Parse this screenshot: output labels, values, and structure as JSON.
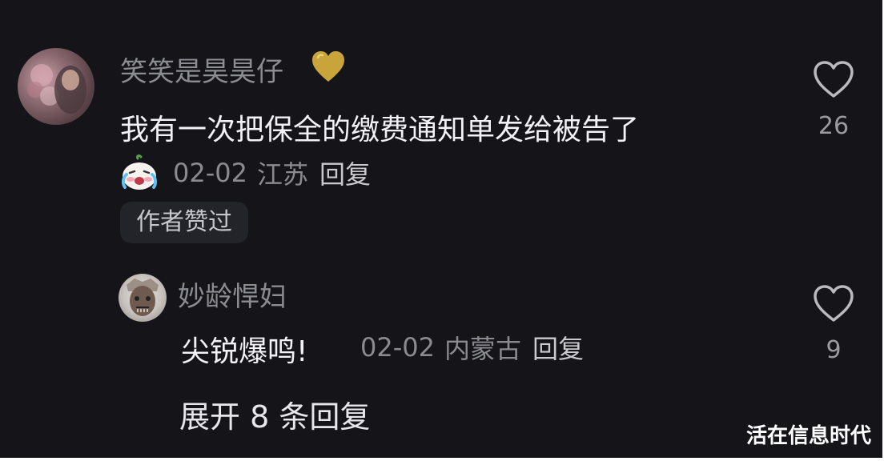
{
  "comments": [
    {
      "author": "笑笑是昊昊仔",
      "author_emoji": "gold-heart-icon",
      "text": "我有一次把保全的缴费通知单发给被告了",
      "sticker": "crying-laughing-sticker-icon",
      "date": "02-02",
      "location": "江苏",
      "reply_label": "回复",
      "badge": "作者赞过",
      "likes": "26"
    },
    {
      "author": "妙龄悍妇",
      "text": "尖锐爆鸣!",
      "date": "02-02",
      "location": "内蒙古",
      "reply_label": "回复",
      "likes": "9"
    }
  ],
  "expand_replies_label": "展开 8 条回复",
  "watermark": "活在信息时代",
  "colors": {
    "background": "#141419",
    "author_name": "#8c8c93",
    "comment_text": "#f2f2f4",
    "meta": "#8a8a91",
    "badge_bg": "#23232a",
    "heart_emoji": "#c8a43a"
  }
}
